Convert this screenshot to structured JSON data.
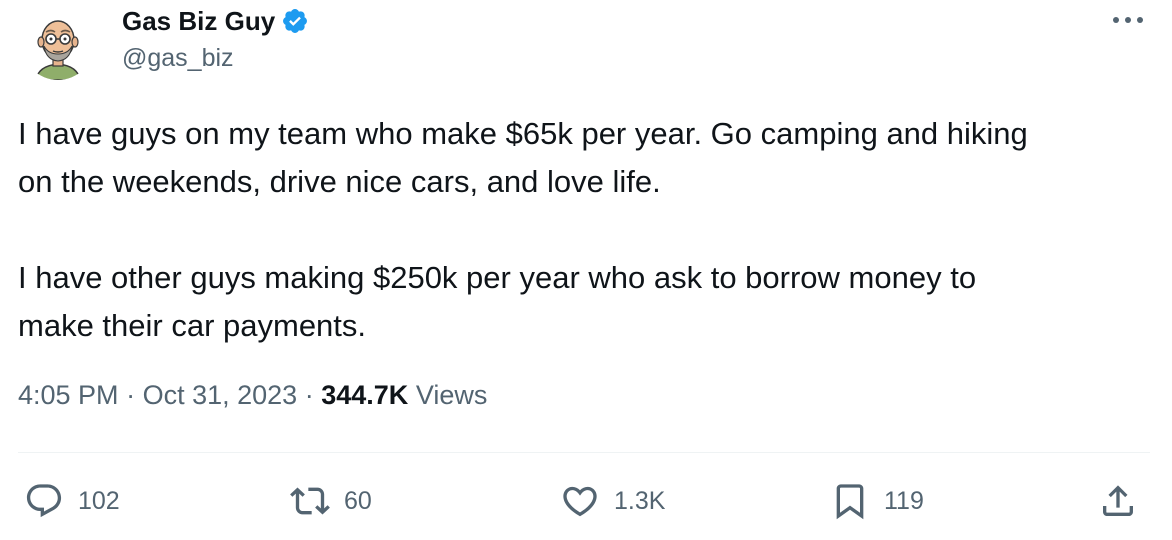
{
  "author": {
    "display_name": "Gas Biz Guy",
    "handle": "@gas_biz",
    "verified": true,
    "avatar_icon": "bald-man-glasses-cartoon-avatar"
  },
  "tweet": {
    "paragraphs": [
      [
        "I have guys on my team who make $65k per year. Go camping and hiking",
        "on the weekends, drive nice cars, and love life."
      ],
      [
        "I have other guys making $250k per year who ask to borrow money to",
        "make their car payments."
      ]
    ],
    "time": "4:05 PM",
    "separator": "·",
    "date": "Oct 31, 2023",
    "views_count": "344.7K",
    "views_label": "Views"
  },
  "actions": {
    "replies": "102",
    "reposts": "60",
    "likes": "1.3K",
    "bookmarks": "119"
  },
  "colors": {
    "text_primary": "#0f1419",
    "text_secondary": "#536471",
    "verified_blue": "#1d9bf0",
    "divider": "#eff3f4"
  }
}
